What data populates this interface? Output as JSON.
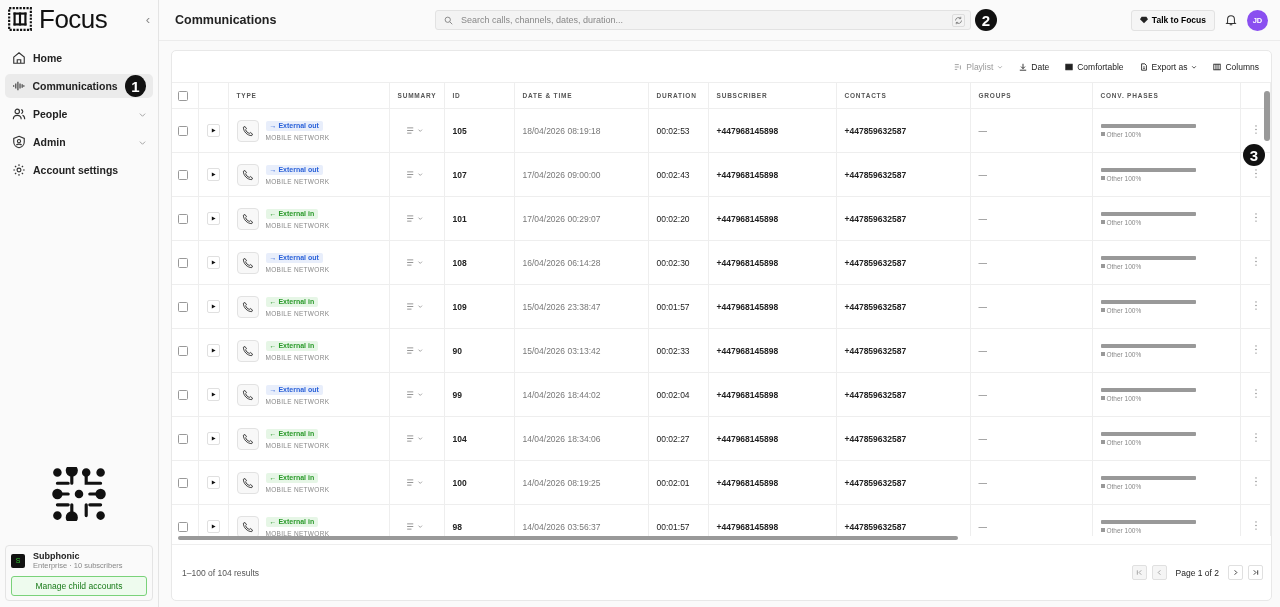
{
  "sidebar": {
    "brand": "Focus",
    "collapse": "‹",
    "items": [
      {
        "label": "Home",
        "selected": false,
        "expandable": false
      },
      {
        "label": "Communications",
        "selected": true,
        "expandable": false
      },
      {
        "label": "People",
        "selected": false,
        "expandable": true
      },
      {
        "label": "Admin",
        "selected": false,
        "expandable": true
      },
      {
        "label": "Account settings",
        "selected": false,
        "expandable": false
      }
    ],
    "account": {
      "initial": "S",
      "name": "Subphonic",
      "plan": "Enterprise · 10 subscribers",
      "button": "Manage child accounts"
    }
  },
  "header": {
    "title": "Communications",
    "search": {
      "placeholder": "Search calls, channels, dates, duration..."
    },
    "assistant": "Talk to Focus",
    "avatar": "JD"
  },
  "callouts": [
    "1",
    "2",
    "3"
  ],
  "toolbar": [
    {
      "label": "Playlist",
      "disabled": true,
      "dropdown": true
    },
    {
      "label": "Date",
      "disabled": false,
      "dropdown": false
    },
    {
      "label": "Comfortable",
      "disabled": false,
      "dropdown": false
    },
    {
      "label": "Export as",
      "disabled": false,
      "dropdown": true
    },
    {
      "label": "Columns",
      "disabled": false,
      "dropdown": false
    }
  ],
  "table": {
    "all_selected": false,
    "columns": [
      "TYPE",
      "SUMMARY",
      "ID",
      "DATE & TIME",
      "DURATION",
      "SUBSCRIBER",
      "CONTACTS",
      "GROUPS",
      "CONV. PHASES"
    ],
    "rows": [
      {
        "selected": false,
        "kind": "out",
        "badge": "→ External out",
        "network": "MOBILE NETWORK",
        "id": "105",
        "datetime": "18/04/2026 08:19:18",
        "duration": "00:02:53",
        "subscriber": "+447968145898",
        "contacts": "+447859632587",
        "groups": "—",
        "phase": "Other 100%",
        "level": 1
      },
      {
        "selected": false,
        "kind": "out",
        "badge": "→ External out",
        "network": "MOBILE NETWORK",
        "id": "107",
        "datetime": "17/04/2026 09:00:00",
        "duration": "00:02:43",
        "subscriber": "+447968145898",
        "contacts": "+447859632587",
        "groups": "—",
        "phase": "Other 100%",
        "level": 1
      },
      {
        "selected": false,
        "kind": "in",
        "badge": "← External in",
        "network": "MOBILE NETWORK",
        "id": "101",
        "datetime": "17/04/2026 00:29:07",
        "duration": "00:02:20",
        "subscriber": "+447968145898",
        "contacts": "+447859632587",
        "groups": "—",
        "phase": "Other 100%",
        "level": 1
      },
      {
        "selected": false,
        "kind": "out",
        "badge": "→ External out",
        "network": "MOBILE NETWORK",
        "id": "108",
        "datetime": "16/04/2026 06:14:28",
        "duration": "00:02:30",
        "subscriber": "+447968145898",
        "contacts": "+447859632587",
        "groups": "—",
        "phase": "Other 100%",
        "level": 1
      },
      {
        "selected": false,
        "kind": "in",
        "badge": "← External in",
        "network": "MOBILE NETWORK",
        "id": "109",
        "datetime": "15/04/2026 23:38:47",
        "duration": "00:01:57",
        "subscriber": "+447968145898",
        "contacts": "+447859632587",
        "groups": "—",
        "phase": "Other 100%",
        "level": 1
      },
      {
        "selected": false,
        "kind": "in",
        "badge": "← External in",
        "network": "MOBILE NETWORK",
        "id": "90",
        "datetime": "15/04/2026 03:13:42",
        "duration": "00:02:33",
        "subscriber": "+447968145898",
        "contacts": "+447859632587",
        "groups": "—",
        "phase": "Other 100%",
        "level": 1
      },
      {
        "selected": false,
        "kind": "out",
        "badge": "→ External out",
        "network": "MOBILE NETWORK",
        "id": "99",
        "datetime": "14/04/2026 18:44:02",
        "duration": "00:02:04",
        "subscriber": "+447968145898",
        "contacts": "+447859632587",
        "groups": "—",
        "phase": "Other 100%",
        "level": 1
      },
      {
        "selected": false,
        "kind": "in",
        "badge": "← External in",
        "network": "MOBILE NETWORK",
        "id": "104",
        "datetime": "14/04/2026 18:34:06",
        "duration": "00:02:27",
        "subscriber": "+447968145898",
        "contacts": "+447859632587",
        "groups": "—",
        "phase": "Other 100%",
        "level": 1
      },
      {
        "selected": false,
        "kind": "in",
        "badge": "← External in",
        "network": "MOBILE NETWORK",
        "id": "100",
        "datetime": "14/04/2026 08:19:25",
        "duration": "00:02:01",
        "subscriber": "+447968145898",
        "contacts": "+447859632587",
        "groups": "—",
        "phase": "Other 100%",
        "level": 1
      },
      {
        "selected": false,
        "kind": "in",
        "badge": "← External in",
        "network": "MOBILE NETWORK",
        "id": "98",
        "datetime": "14/04/2026 03:56:37",
        "duration": "00:01:57",
        "subscriber": "+447968145898",
        "contacts": "+447859632587",
        "groups": "—",
        "phase": "Other 100%",
        "level": 1
      }
    ]
  },
  "footer": {
    "results": "1–100 of 104 results",
    "page": "Page 1 of 2"
  }
}
